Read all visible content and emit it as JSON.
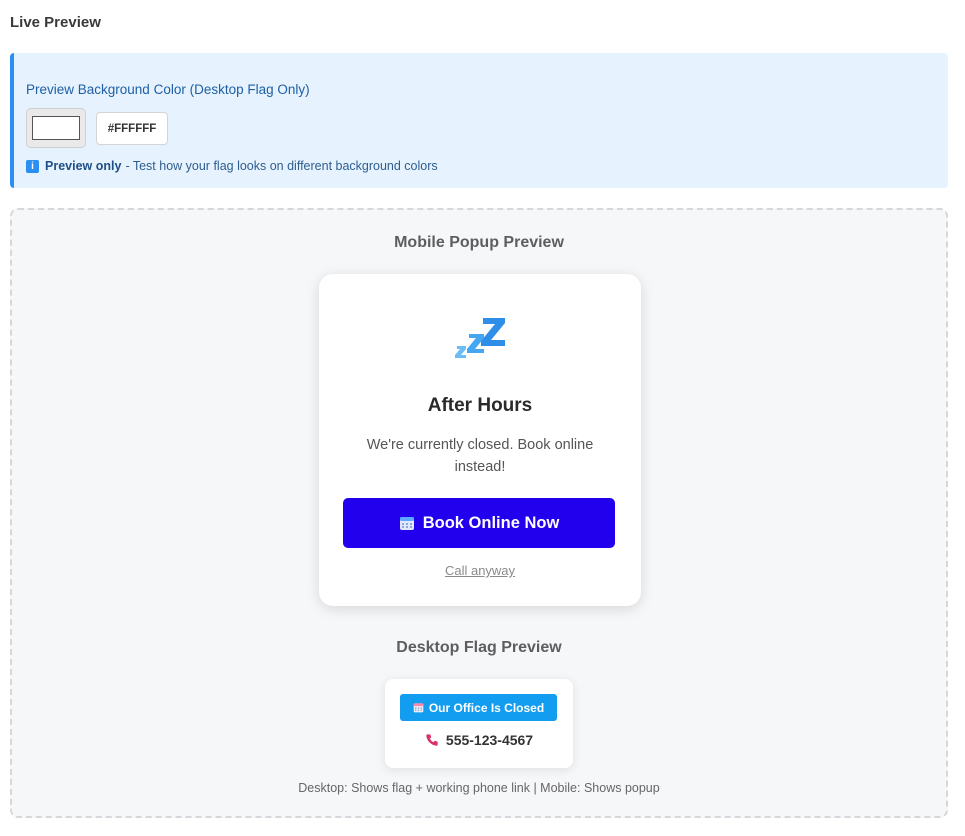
{
  "page": {
    "title": "Live Preview"
  },
  "background_control": {
    "label": "Preview Background Color (Desktop Flag Only)",
    "color_value": "#FFFFFF",
    "note_bold": "Preview only",
    "note_text": "- Test how your flag looks on different background colors",
    "info_icon": "info-icon"
  },
  "mobile_preview": {
    "section_title": "Mobile Popup Preview",
    "icon": "zzz-sleep-icon",
    "title": "After Hours",
    "message": "We're currently closed. Book online instead!",
    "button_label": "Book Online Now",
    "button_icon": "calendar-icon",
    "button_color": "#2200EE",
    "secondary_link": "Call anyway"
  },
  "desktop_preview": {
    "section_title": "Desktop Flag Preview",
    "button_label": "Our Office Is Closed",
    "button_icon": "calendar-icon",
    "button_color": "#139DF0",
    "phone_icon": "phone-icon",
    "phone_number": "555-123-4567"
  },
  "footer": {
    "note": "Desktop: Shows flag + working phone link | Mobile: Shows popup"
  }
}
